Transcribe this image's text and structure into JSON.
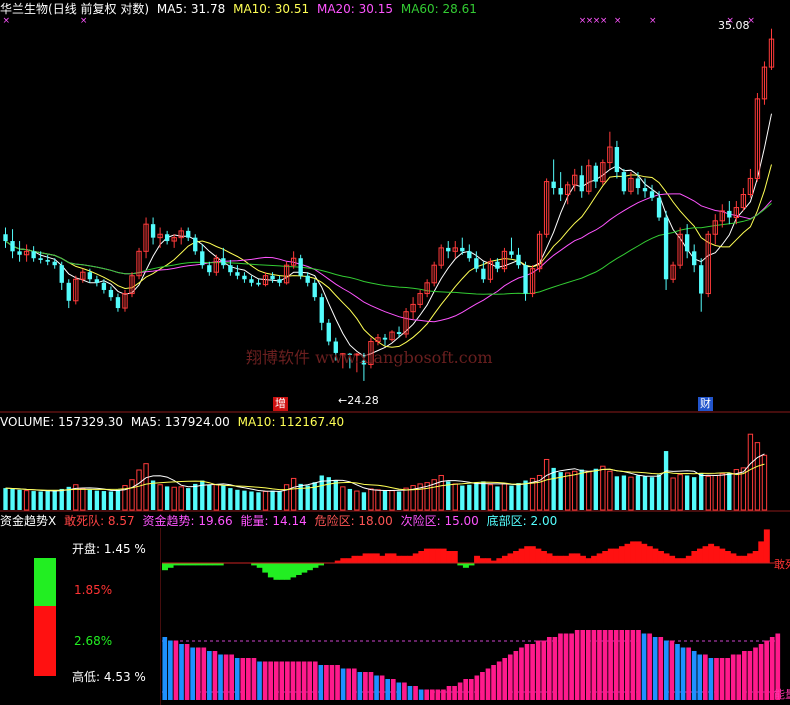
{
  "colors": {
    "up": "#ff3b3b",
    "down": "#54fcfc",
    "ma5": "#ffffff",
    "ma10": "#ffff55",
    "ma20": "#ff55ff",
    "ma60": "#33cc33",
    "blue_bar": "#1e90ff",
    "pink_bar": "#ff1a8c",
    "green_area": "#22ee22",
    "red_area": "#ff1111"
  },
  "price_panel": {
    "stock_name": "华兰生物",
    "period_label": "(日线 前复权 对数)",
    "ma5_label": "MA5: 31.78",
    "ma10_label": "MA10: 30.51",
    "ma20_label": "MA20: 30.15",
    "ma60_label": "MA60: 28.61",
    "high_marker": "35.08",
    "low_marker": "24.28",
    "event_mark_left": "增",
    "event_mark_right": "财",
    "watermark": "翔博软件 www.xiangbosoft.com"
  },
  "volume_panel": {
    "volume_label": "VOLUME: 157329.30",
    "ma5_label": "MA5: 137924.00",
    "ma10_label": "MA10: 112167.40"
  },
  "indicator_panel": {
    "name": "资金趋势X",
    "label_a": "敢死队: 8.57",
    "label_b": "资金趋势: 19.66",
    "label_c": "能量: 14.14",
    "label_d": "危险区: 18.00",
    "label_e": "次险区: 15.00",
    "label_f": "底部区: 2.00",
    "right_tag_top": "敢死",
    "right_tag_bottom": "能量"
  },
  "side_panel": {
    "open_label": "开盘:",
    "open_value": "1.45 %",
    "upper_value": "1.85%",
    "lower_value": "2.68%",
    "range_label": "高低:",
    "range_value": "4.53 %"
  },
  "chart_data": {
    "type": "candlestick",
    "title": "华兰生物 (日线 前复权 对数)",
    "price_markers": {
      "high": 35.08,
      "low": 24.28
    },
    "moving_averages_latest": {
      "MA5": 31.78,
      "MA10": 30.51,
      "MA20": 30.15,
      "MA60": 28.61
    },
    "volume_latest": {
      "VOLUME": 157329.3,
      "MA5": 137924.0,
      "MA10": 112167.4
    },
    "indicator_latest": {
      "敢死队": 8.57,
      "资金趋势": 19.66,
      "能量": 14.14,
      "危险区": 18.0,
      "次险区": 15.0,
      "底部区": 2.0
    },
    "candles": [
      {
        "o": 28.3,
        "h": 28.5,
        "l": 27.9,
        "c": 28.1
      },
      {
        "o": 28.1,
        "h": 28.45,
        "l": 27.6,
        "c": 27.8
      },
      {
        "o": 27.8,
        "h": 28.1,
        "l": 27.5,
        "c": 27.7
      },
      {
        "o": 27.7,
        "h": 28.0,
        "l": 27.5,
        "c": 27.8
      },
      {
        "o": 27.8,
        "h": 27.95,
        "l": 27.5,
        "c": 27.6
      },
      {
        "o": 27.6,
        "h": 27.8,
        "l": 27.45,
        "c": 27.55
      },
      {
        "o": 27.55,
        "h": 27.7,
        "l": 27.4,
        "c": 27.5
      },
      {
        "o": 27.5,
        "h": 27.6,
        "l": 27.3,
        "c": 27.4
      },
      {
        "o": 27.4,
        "h": 27.5,
        "l": 26.7,
        "c": 26.9
      },
      {
        "o": 26.9,
        "h": 27.0,
        "l": 26.2,
        "c": 26.4
      },
      {
        "o": 26.4,
        "h": 27.1,
        "l": 26.3,
        "c": 27.0
      },
      {
        "o": 27.0,
        "h": 27.3,
        "l": 26.9,
        "c": 27.2
      },
      {
        "o": 27.2,
        "h": 27.3,
        "l": 26.9,
        "c": 27.0
      },
      {
        "o": 27.0,
        "h": 27.1,
        "l": 26.8,
        "c": 26.9
      },
      {
        "o": 26.9,
        "h": 27.0,
        "l": 26.6,
        "c": 26.7
      },
      {
        "o": 26.7,
        "h": 26.8,
        "l": 26.4,
        "c": 26.5
      },
      {
        "o": 26.5,
        "h": 26.6,
        "l": 26.1,
        "c": 26.2
      },
      {
        "o": 26.2,
        "h": 26.7,
        "l": 26.1,
        "c": 26.6
      },
      {
        "o": 26.6,
        "h": 27.2,
        "l": 26.5,
        "c": 27.1
      },
      {
        "o": 27.1,
        "h": 27.9,
        "l": 27.0,
        "c": 27.8
      },
      {
        "o": 27.8,
        "h": 28.8,
        "l": 27.6,
        "c": 28.6
      },
      {
        "o": 28.6,
        "h": 28.8,
        "l": 28.0,
        "c": 28.2
      },
      {
        "o": 28.2,
        "h": 28.5,
        "l": 27.9,
        "c": 28.3
      },
      {
        "o": 28.3,
        "h": 28.4,
        "l": 28.0,
        "c": 28.1
      },
      {
        "o": 28.1,
        "h": 28.3,
        "l": 27.9,
        "c": 28.2
      },
      {
        "o": 28.2,
        "h": 28.5,
        "l": 28.0,
        "c": 28.4
      },
      {
        "o": 28.4,
        "h": 28.5,
        "l": 28.1,
        "c": 28.2
      },
      {
        "o": 28.2,
        "h": 28.3,
        "l": 27.7,
        "c": 27.8
      },
      {
        "o": 27.8,
        "h": 28.0,
        "l": 27.3,
        "c": 27.4
      },
      {
        "o": 27.4,
        "h": 27.5,
        "l": 27.1,
        "c": 27.2
      },
      {
        "o": 27.2,
        "h": 27.7,
        "l": 27.1,
        "c": 27.6
      },
      {
        "o": 27.6,
        "h": 27.9,
        "l": 27.3,
        "c": 27.4
      },
      {
        "o": 27.4,
        "h": 27.55,
        "l": 27.1,
        "c": 27.2
      },
      {
        "o": 27.2,
        "h": 27.4,
        "l": 27.0,
        "c": 27.1
      },
      {
        "o": 27.1,
        "h": 27.2,
        "l": 26.9,
        "c": 27.0
      },
      {
        "o": 27.0,
        "h": 27.1,
        "l": 26.8,
        "c": 26.9
      },
      {
        "o": 26.9,
        "h": 27.0,
        "l": 26.8,
        "c": 26.85
      },
      {
        "o": 26.85,
        "h": 27.2,
        "l": 26.8,
        "c": 27.1
      },
      {
        "o": 27.1,
        "h": 27.2,
        "l": 26.9,
        "c": 27.0
      },
      {
        "o": 27.0,
        "h": 27.1,
        "l": 26.8,
        "c": 26.9
      },
      {
        "o": 26.9,
        "h": 27.5,
        "l": 26.85,
        "c": 27.4
      },
      {
        "o": 27.4,
        "h": 27.8,
        "l": 27.3,
        "c": 27.6
      },
      {
        "o": 27.6,
        "h": 27.7,
        "l": 27.0,
        "c": 27.1
      },
      {
        "o": 27.1,
        "h": 27.2,
        "l": 26.8,
        "c": 26.9
      },
      {
        "o": 26.9,
        "h": 27.0,
        "l": 26.4,
        "c": 26.5
      },
      {
        "o": 26.5,
        "h": 26.6,
        "l": 25.6,
        "c": 25.8
      },
      {
        "o": 25.8,
        "h": 25.9,
        "l": 25.2,
        "c": 25.3
      },
      {
        "o": 25.3,
        "h": 25.4,
        "l": 24.8,
        "c": 25.0
      },
      {
        "o": 24.95,
        "h": 25.0,
        "l": 24.6,
        "c": 24.98
      },
      {
        "o": 24.98,
        "h": 25.0,
        "l": 24.6,
        "c": 24.95
      },
      {
        "o": 24.95,
        "h": 25.0,
        "l": 24.5,
        "c": 24.97
      },
      {
        "o": 24.8,
        "h": 25.0,
        "l": 24.28,
        "c": 24.7
      },
      {
        "o": 24.7,
        "h": 25.4,
        "l": 24.6,
        "c": 25.3
      },
      {
        "o": 25.3,
        "h": 25.5,
        "l": 25.2,
        "c": 25.4
      },
      {
        "o": 25.4,
        "h": 25.5,
        "l": 25.2,
        "c": 25.35
      },
      {
        "o": 25.35,
        "h": 25.6,
        "l": 25.3,
        "c": 25.55
      },
      {
        "o": 25.55,
        "h": 25.7,
        "l": 25.4,
        "c": 25.5
      },
      {
        "o": 25.5,
        "h": 26.2,
        "l": 25.4,
        "c": 26.1
      },
      {
        "o": 26.1,
        "h": 26.5,
        "l": 25.9,
        "c": 26.3
      },
      {
        "o": 26.3,
        "h": 26.7,
        "l": 26.2,
        "c": 26.6
      },
      {
        "o": 26.6,
        "h": 27.0,
        "l": 26.5,
        "c": 26.9
      },
      {
        "o": 26.9,
        "h": 27.5,
        "l": 26.8,
        "c": 27.4
      },
      {
        "o": 27.4,
        "h": 28.0,
        "l": 27.3,
        "c": 27.9
      },
      {
        "o": 27.9,
        "h": 28.1,
        "l": 27.6,
        "c": 27.8
      },
      {
        "o": 27.8,
        "h": 28.1,
        "l": 27.6,
        "c": 27.9
      },
      {
        "o": 27.9,
        "h": 28.2,
        "l": 27.7,
        "c": 27.8
      },
      {
        "o": 27.8,
        "h": 28.0,
        "l": 27.5,
        "c": 27.6
      },
      {
        "o": 27.6,
        "h": 27.8,
        "l": 27.2,
        "c": 27.3
      },
      {
        "o": 27.3,
        "h": 27.5,
        "l": 26.9,
        "c": 27.0
      },
      {
        "o": 27.0,
        "h": 27.6,
        "l": 26.9,
        "c": 27.5
      },
      {
        "o": 27.5,
        "h": 27.6,
        "l": 27.2,
        "c": 27.3
      },
      {
        "o": 27.3,
        "h": 27.9,
        "l": 27.2,
        "c": 27.8
      },
      {
        "o": 27.8,
        "h": 28.2,
        "l": 27.6,
        "c": 27.7
      },
      {
        "o": 27.7,
        "h": 27.9,
        "l": 27.3,
        "c": 27.4
      },
      {
        "o": 27.4,
        "h": 27.5,
        "l": 26.4,
        "c": 26.6
      },
      {
        "o": 26.6,
        "h": 27.4,
        "l": 26.5,
        "c": 27.3
      },
      {
        "o": 27.3,
        "h": 28.4,
        "l": 27.2,
        "c": 28.3
      },
      {
        "o": 28.3,
        "h": 30.0,
        "l": 28.2,
        "c": 29.9
      },
      {
        "o": 29.9,
        "h": 30.6,
        "l": 29.5,
        "c": 29.7
      },
      {
        "o": 29.7,
        "h": 30.2,
        "l": 29.3,
        "c": 29.5
      },
      {
        "o": 29.5,
        "h": 29.9,
        "l": 29.2,
        "c": 29.8
      },
      {
        "o": 29.8,
        "h": 30.3,
        "l": 29.6,
        "c": 30.1
      },
      {
        "o": 30.1,
        "h": 30.4,
        "l": 29.4,
        "c": 29.6
      },
      {
        "o": 29.6,
        "h": 30.6,
        "l": 29.5,
        "c": 30.4
      },
      {
        "o": 30.4,
        "h": 30.5,
        "l": 29.7,
        "c": 29.9
      },
      {
        "o": 29.9,
        "h": 30.6,
        "l": 29.8,
        "c": 30.5
      },
      {
        "o": 30.5,
        "h": 31.5,
        "l": 30.3,
        "c": 31.0
      },
      {
        "o": 31.0,
        "h": 31.2,
        "l": 30.0,
        "c": 30.2
      },
      {
        "o": 30.2,
        "h": 30.3,
        "l": 29.5,
        "c": 29.6
      },
      {
        "o": 29.6,
        "h": 30.2,
        "l": 29.5,
        "c": 30.0
      },
      {
        "o": 30.0,
        "h": 30.2,
        "l": 29.5,
        "c": 29.7
      },
      {
        "o": 29.7,
        "h": 30.0,
        "l": 29.4,
        "c": 29.6
      },
      {
        "o": 29.6,
        "h": 29.8,
        "l": 29.3,
        "c": 29.4
      },
      {
        "o": 29.4,
        "h": 29.6,
        "l": 28.7,
        "c": 28.8
      },
      {
        "o": 28.8,
        "h": 29.0,
        "l": 26.7,
        "c": 27.0
      },
      {
        "o": 27.0,
        "h": 27.5,
        "l": 26.9,
        "c": 27.4
      },
      {
        "o": 27.4,
        "h": 28.5,
        "l": 27.3,
        "c": 28.3
      },
      {
        "o": 28.3,
        "h": 28.6,
        "l": 27.6,
        "c": 27.8
      },
      {
        "o": 27.8,
        "h": 28.0,
        "l": 27.2,
        "c": 27.4
      },
      {
        "o": 27.4,
        "h": 27.6,
        "l": 26.1,
        "c": 26.6
      },
      {
        "o": 26.6,
        "h": 28.4,
        "l": 26.5,
        "c": 28.3
      },
      {
        "o": 28.3,
        "h": 28.9,
        "l": 28.0,
        "c": 28.7
      },
      {
        "o": 28.7,
        "h": 29.2,
        "l": 28.5,
        "c": 29.0
      },
      {
        "o": 29.0,
        "h": 29.3,
        "l": 28.6,
        "c": 28.8
      },
      {
        "o": 28.8,
        "h": 29.3,
        "l": 28.6,
        "c": 29.1
      },
      {
        "o": 29.1,
        "h": 29.7,
        "l": 29.0,
        "c": 29.5
      },
      {
        "o": 29.5,
        "h": 30.3,
        "l": 29.4,
        "c": 30.0
      },
      {
        "o": 30.0,
        "h": 32.8,
        "l": 29.9,
        "c": 32.6
      },
      {
        "o": 32.6,
        "h": 33.9,
        "l": 32.4,
        "c": 33.7
      },
      {
        "o": 33.7,
        "h": 35.08,
        "l": 33.6,
        "c": 34.7
      }
    ],
    "volume": [
      52,
      50,
      48,
      46,
      45,
      44,
      45,
      46,
      50,
      55,
      60,
      50,
      48,
      46,
      45,
      44,
      48,
      58,
      72,
      95,
      110,
      70,
      60,
      56,
      54,
      55,
      52,
      62,
      70,
      60,
      60,
      58,
      52,
      48,
      46,
      44,
      42,
      44,
      46,
      45,
      60,
      75,
      62,
      58,
      66,
      82,
      78,
      70,
      55,
      50,
      45,
      42,
      50,
      48,
      46,
      46,
      44,
      52,
      58,
      62,
      65,
      72,
      82,
      68,
      62,
      58,
      60,
      66,
      68,
      60,
      56,
      62,
      58,
      64,
      70,
      75,
      82,
      120,
      100,
      90,
      88,
      92,
      96,
      92,
      98,
      104,
      92,
      80,
      82,
      78,
      82,
      80,
      78,
      84,
      140,
      76,
      84,
      82,
      78,
      88,
      80,
      82,
      86,
      88,
      96,
      100,
      180,
      160,
      130
    ],
    "energy": [
      -3,
      -2,
      -1,
      -1,
      -1,
      -1,
      -1,
      -1,
      -1,
      -1,
      -1,
      0,
      0,
      0,
      0,
      0,
      -1,
      -2,
      -4,
      -6,
      -7,
      -7,
      -7,
      -6,
      -5,
      -4,
      -3,
      -2,
      -1,
      0,
      0,
      1,
      2,
      2,
      3,
      3,
      4,
      4,
      4,
      3,
      4,
      4,
      3,
      3,
      3,
      4,
      5,
      6,
      6,
      6,
      6,
      5,
      5,
      -1,
      -2,
      -1,
      3,
      2,
      2,
      1,
      2,
      3,
      4,
      5,
      6,
      7,
      7,
      6,
      5,
      4,
      3,
      3,
      3,
      4,
      4,
      3,
      2,
      3,
      4,
      5,
      6,
      6,
      7,
      8,
      9,
      9,
      8,
      7,
      6,
      5,
      4,
      3,
      2,
      2,
      3,
      5,
      6,
      7,
      8,
      7,
      6,
      5,
      4,
      3,
      3,
      4,
      5,
      9,
      14
    ],
    "trend": [
      18,
      17,
      17,
      16,
      16,
      15,
      15,
      15,
      14,
      14,
      13,
      13,
      13,
      12,
      12,
      12,
      12,
      11,
      11,
      11,
      11,
      11,
      11,
      11,
      11,
      11,
      11,
      11,
      10,
      10,
      10,
      10,
      9,
      9,
      9,
      8,
      8,
      8,
      7,
      7,
      6,
      6,
      5,
      5,
      4,
      4,
      3,
      3,
      3,
      3,
      3,
      4,
      4,
      5,
      6,
      6,
      7,
      8,
      9,
      10,
      11,
      12,
      13,
      14,
      15,
      16,
      16,
      17,
      17,
      18,
      18,
      19,
      19,
      19,
      20,
      20,
      20,
      20,
      20,
      20,
      20,
      20,
      20,
      20,
      20,
      20,
      19,
      19,
      18,
      18,
      17,
      17,
      16,
      15,
      15,
      14,
      13,
      13,
      12,
      12,
      12,
      12,
      13,
      13,
      14,
      14,
      15,
      16,
      17,
      18,
      19
    ]
  }
}
